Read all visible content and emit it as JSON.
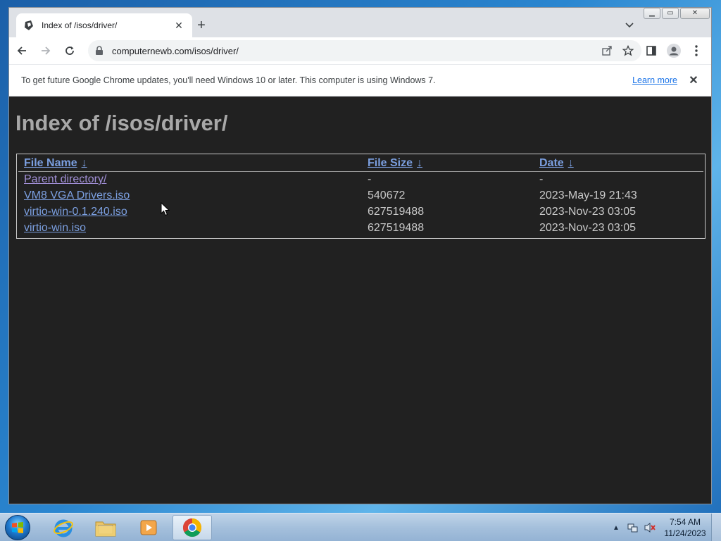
{
  "browser": {
    "tab_title": "Index of /isos/driver/",
    "new_tab_label": "+",
    "url": "computernewb.com/isos/driver/",
    "infobar": {
      "message": "To get future Google Chrome updates, you'll need Windows 10 or later. This computer is using Windows 7.",
      "link": "Learn more"
    }
  },
  "page": {
    "title": "Index of /isos/driver/",
    "headers": {
      "name": "File Name",
      "size": "File Size",
      "date": "Date",
      "sort_glyph": "↓"
    },
    "rows": [
      {
        "name": "Parent directory/",
        "size": "-",
        "date": "-",
        "visited": true
      },
      {
        "name": "VM8 VGA Drivers.iso",
        "size": "540672",
        "date": "2023-May-19 21:43",
        "visited": false
      },
      {
        "name": "virtio-win-0.1.240.iso",
        "size": "627519488",
        "date": "2023-Nov-23 03:05",
        "visited": false
      },
      {
        "name": "virtio-win.iso",
        "size": "627519488",
        "date": "2023-Nov-23 03:05",
        "visited": false
      }
    ]
  },
  "taskbar": {
    "apps": [
      "internet-explorer",
      "windows-explorer",
      "media-player",
      "chrome"
    ],
    "active_app": "chrome",
    "clock_time": "7:54 AM",
    "clock_date": "11/24/2023"
  },
  "colors": {
    "page_background": "#212121",
    "link": "#7b9fe0",
    "visited_link": "#a18fd6"
  }
}
